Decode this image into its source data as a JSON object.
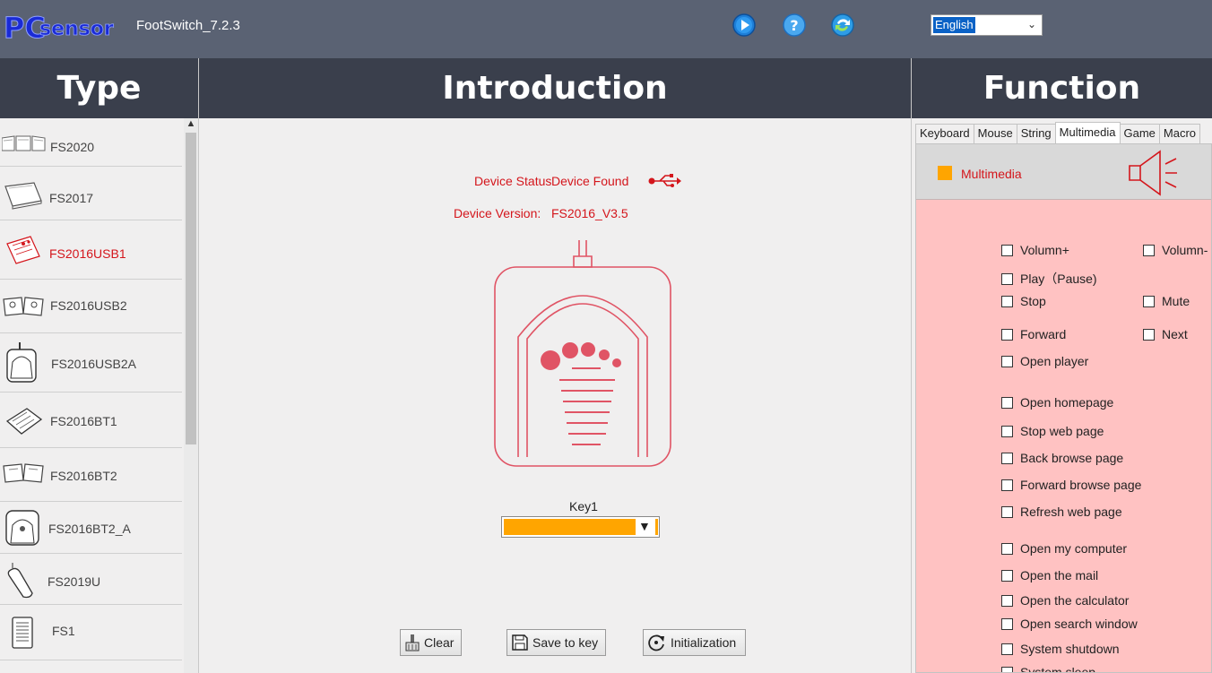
{
  "app": {
    "logo_text": "PCsensor",
    "title": "FootSwitch_7.2.3"
  },
  "toolbar_icons": [
    "play-icon",
    "help-icon",
    "refresh-icon"
  ],
  "language": {
    "selected": "English"
  },
  "headers": {
    "type": "Type",
    "introduction": "Introduction",
    "function": "Function"
  },
  "types": [
    {
      "label": "FS2020",
      "icon": "fs2020-device-icon"
    },
    {
      "label": "FS2017",
      "icon": "fs2017-device-icon"
    },
    {
      "label": "FS2016USB1",
      "icon": "fs2016usb1-device-icon",
      "active": true
    },
    {
      "label": "FS2016USB2",
      "icon": "fs2016usb2-device-icon"
    },
    {
      "label": "FS2016USB2A",
      "icon": "fs2016usb2a-device-icon"
    },
    {
      "label": "FS2016BT1",
      "icon": "fs2016bt1-device-icon"
    },
    {
      "label": "FS2016BT2",
      "icon": "fs2016bt2-device-icon"
    },
    {
      "label": "FS2016BT2_A",
      "icon": "fs2016bt2a-device-icon"
    },
    {
      "label": "FS2019U",
      "icon": "fs2019u-device-icon"
    },
    {
      "label": "FS1",
      "icon": "fs1-device-icon"
    }
  ],
  "intro": {
    "status_label": "Device Status",
    "status_value": "Device Found",
    "version_label": "Device Version:",
    "version_value": "FS2016_V3.5",
    "key_label": "Key1",
    "key_value": "",
    "buttons": {
      "clear": "Clear",
      "save": "Save to key",
      "init": "Initialization"
    }
  },
  "function": {
    "tabs": [
      "Keyboard",
      "Mouse",
      "String",
      "Multimedia",
      "Game",
      "Macro"
    ],
    "active_tab": "Multimedia",
    "section_title": "Multimedia",
    "options_col1": [
      "Volumn+",
      "Play（Pause)",
      "Stop",
      "Forward",
      "Open player",
      "Open homepage",
      "Stop web page",
      "Back browse page",
      "Forward browse page",
      "Refresh web page",
      "Open my computer",
      "Open the mail",
      "Open the calculator",
      "Open search window",
      "System shutdown",
      "System sleep"
    ],
    "options_col2": [
      "Volumn-",
      "Mute",
      "Next"
    ]
  },
  "colors": {
    "accent_red": "#d4161c",
    "orange": "#ffa500",
    "pink_panel": "#ffc2c2",
    "header_dark": "#3a3f4c",
    "topbar": "#5a6273"
  }
}
